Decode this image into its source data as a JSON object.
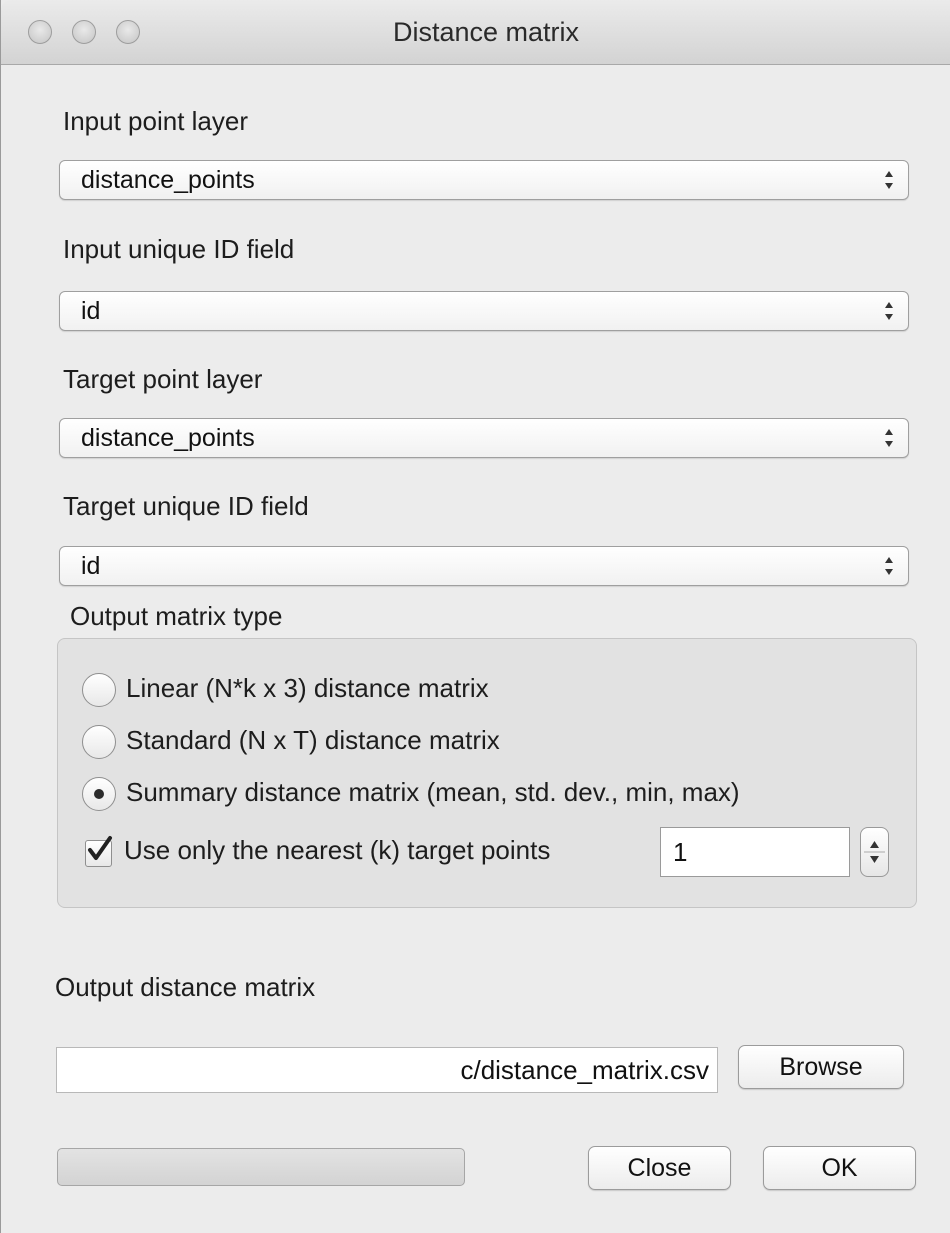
{
  "window": {
    "title": "Distance matrix"
  },
  "fields": {
    "input_layer_label": "Input point layer",
    "input_layer_value": "distance_points",
    "input_id_label": "Input unique ID field",
    "input_id_value": "id",
    "target_layer_label": "Target point layer",
    "target_layer_value": "distance_points",
    "target_id_label": "Target unique ID field",
    "target_id_value": "id"
  },
  "output_type": {
    "label": "Output matrix type",
    "options": [
      {
        "label": "Linear (N*k x 3) distance matrix",
        "selected": false
      },
      {
        "label": "Standard (N x T) distance matrix",
        "selected": false
      },
      {
        "label": "Summary distance matrix (mean, std. dev., min, max)",
        "selected": true
      }
    ],
    "nearest_label": "Use only the nearest (k) target points",
    "nearest_checked": true,
    "nearest_value": "1"
  },
  "output": {
    "label": "Output distance matrix",
    "path_value": "c/distance_matrix.csv",
    "browse_label": "Browse"
  },
  "footer": {
    "progress": 0,
    "close_label": "Close",
    "ok_label": "OK"
  },
  "icons": {
    "window_buttons": [
      "close-button",
      "minimize-button",
      "zoom-button"
    ],
    "combo_arrows": "updown-arrows-icon",
    "checkmark": "checkmark-icon"
  }
}
